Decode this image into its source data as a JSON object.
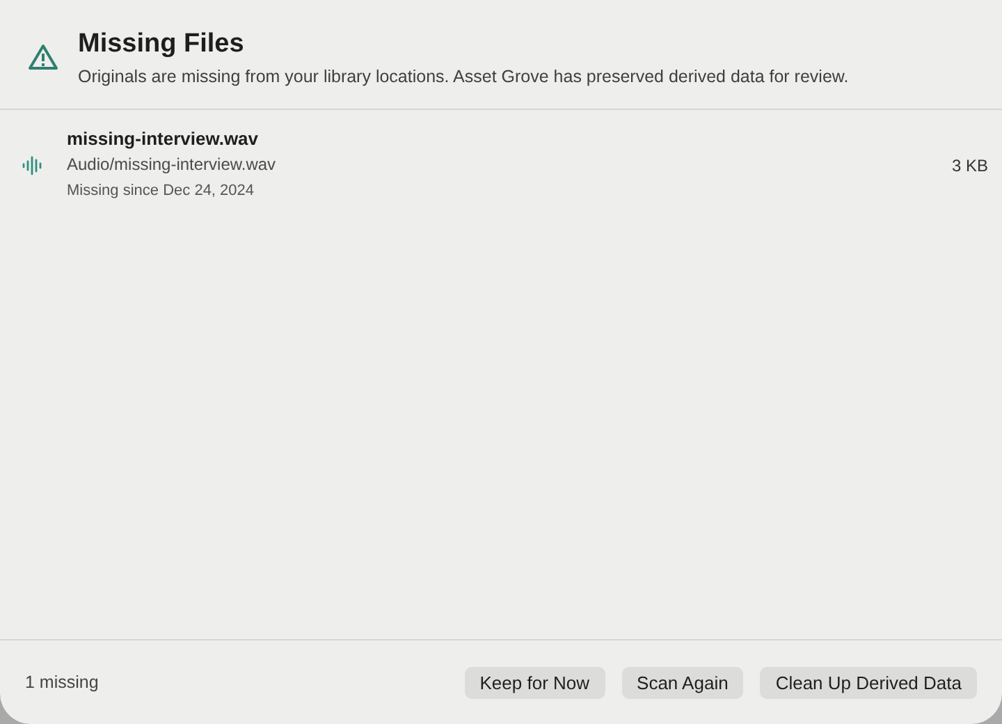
{
  "dialog": {
    "title": "Missing Files",
    "message": "Originals are missing from your library locations. Asset Grove has preserved derived data for review."
  },
  "files": [
    {
      "kind": "audio",
      "name": "missing-interview.wav",
      "path": "Audio/missing-interview.wav",
      "since": "Missing since Dec 24, 2024",
      "size": "3 KB"
    }
  ],
  "footer": {
    "count": "1 missing",
    "buttons": [
      "Keep for Now",
      "Scan Again",
      "Clean Up Derived Data"
    ]
  }
}
